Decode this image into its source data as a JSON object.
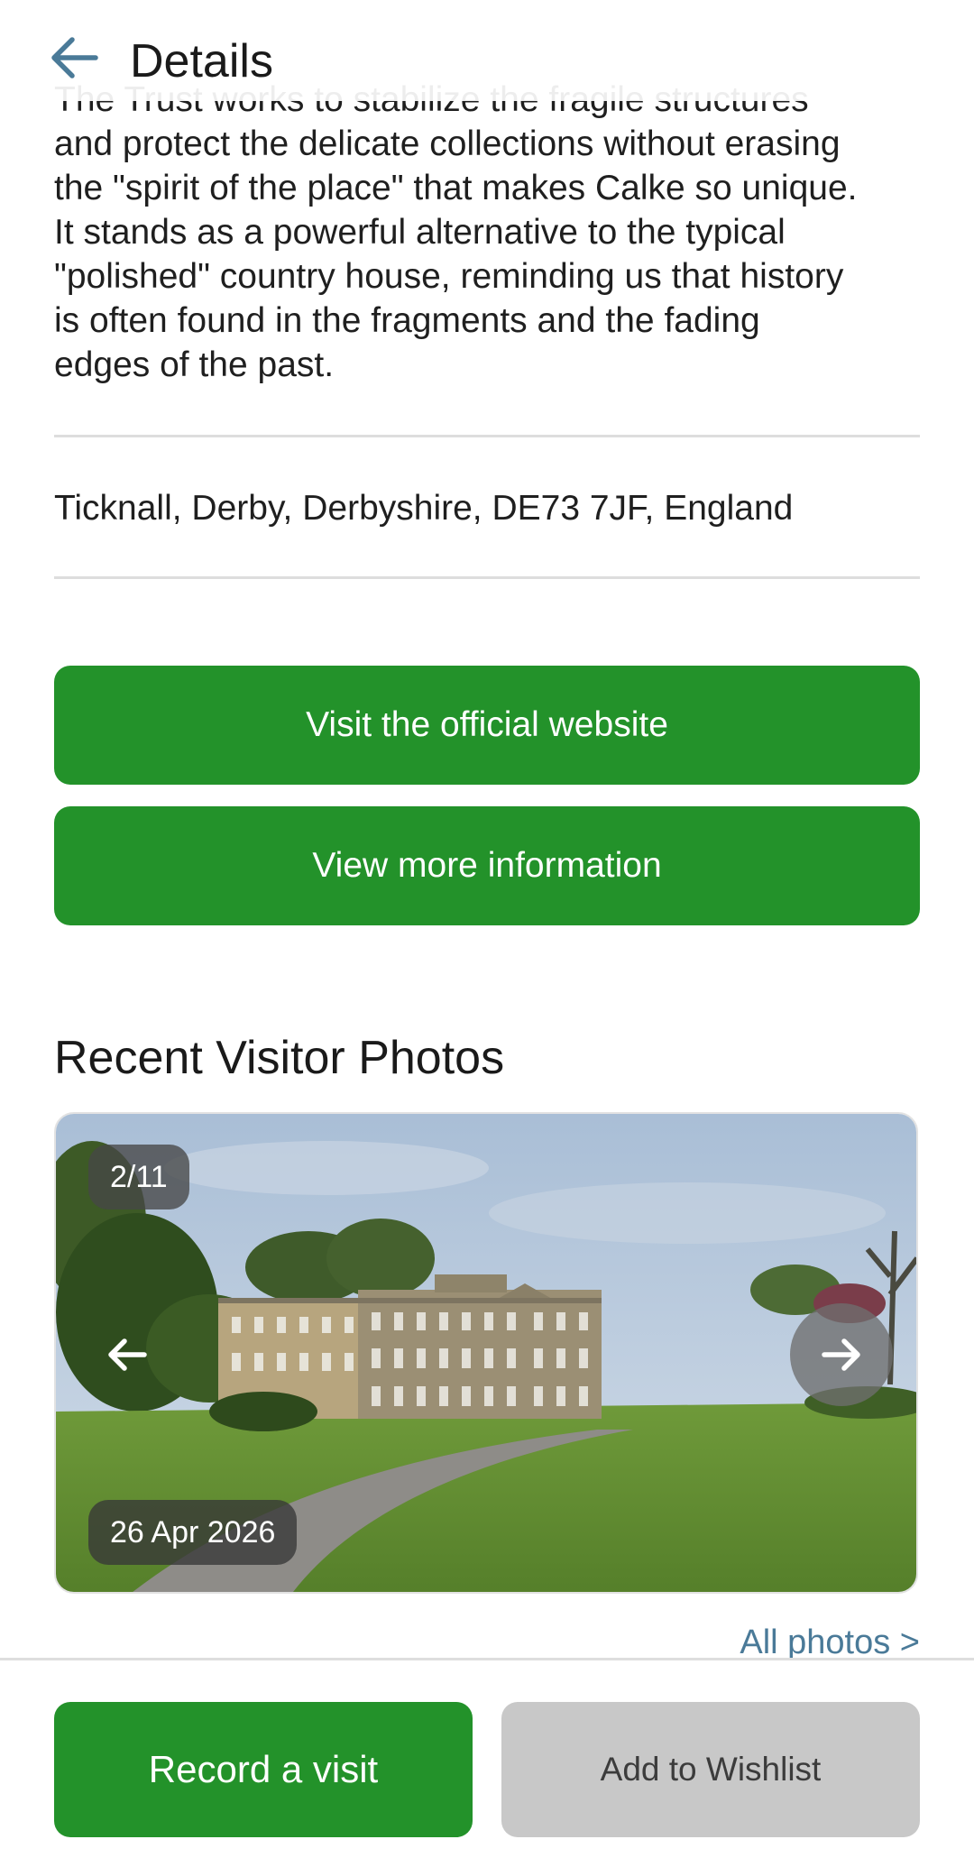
{
  "header": {
    "title": "Details",
    "back_icon": "arrow-left-icon"
  },
  "description": {
    "partial_top_line": "The Trust works to stabilize the fragile structures",
    "lines": [
      "and protect the delicate collections without erasing",
      "the \"spirit of the place\" that makes Calke so unique.",
      "It stands as a powerful alternative to the typical",
      "\"polished\" country house, reminding us that history",
      "is often found in the fragments and the fading",
      "edges of the past."
    ]
  },
  "address": "Ticknall, Derby, Derbyshire, DE73 7JF, England",
  "actions": {
    "website_label": "Visit the official website",
    "more_info_label": "View more information"
  },
  "photos": {
    "section_title": "Recent Visitor Photos",
    "counter": "2/11",
    "date": "26 Apr 2026",
    "prev_icon": "arrow-left-icon",
    "next_icon": "arrow-right-icon",
    "all_photos_label": "All photos >"
  },
  "bottom_bar": {
    "record_label": "Record a visit",
    "wishlist_label": "Add to Wishlist"
  },
  "colors": {
    "accent_green": "#23922a",
    "link_blue": "#4a7a98",
    "back_arrow": "#4a7a98",
    "disabled_gray": "#c8c8c8"
  }
}
